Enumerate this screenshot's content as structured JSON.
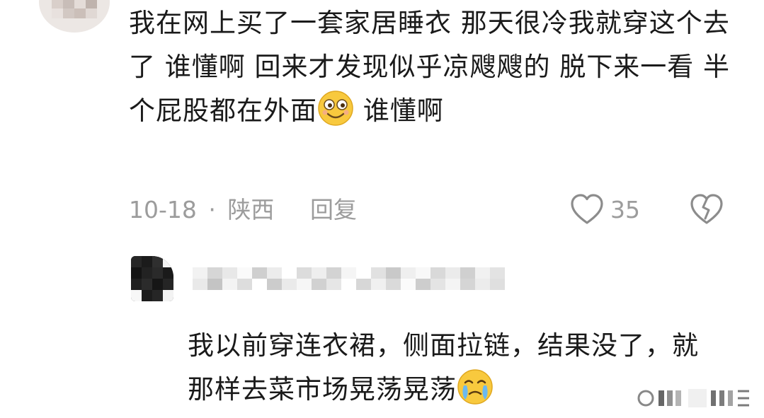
{
  "comment": {
    "text_part1": "我在网上买了一套家居睡衣 那天很冷我就穿这个去了 谁懂啊 回来才发现似乎凉飕飕的 脱下来一看 半个屁股都在外面",
    "emoji": "smile-emoji",
    "text_part2": " 谁懂啊",
    "date": "10-18",
    "separator": "·",
    "location": "陕西",
    "reply_label": "回复",
    "like_count": "35"
  },
  "reply": {
    "text_part1": "我以前穿连衣裙，侧面拉链，结果没了，就那样去菜市场晃荡晃荡",
    "emoji": "crying-emoji"
  },
  "colors": {
    "text": "#1a1a1a",
    "meta": "#9c9c9c",
    "emoji_yellow": "#f8c93e"
  }
}
